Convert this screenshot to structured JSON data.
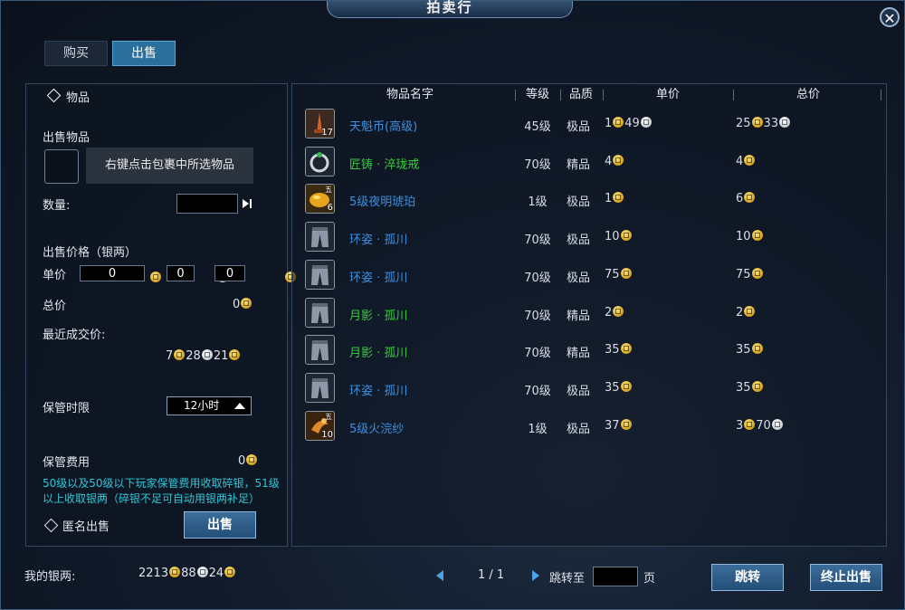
{
  "window": {
    "title": "拍卖行"
  },
  "tabs": {
    "buy": "购买",
    "sell": "出售"
  },
  "left": {
    "header": "物品",
    "sell_item_label": "出售物品",
    "hint": "右键点击包裹中所选物品",
    "quantity_label": "数量:",
    "quantity_value": "",
    "price_section_label": "出售价格（银两）",
    "unit_price_label": "单价",
    "unit_price": {
      "gold": "0",
      "silver": "0",
      "copper": "0"
    },
    "total_label": "总价",
    "total_value": "0",
    "recent_label": "最近成交价:",
    "recent": {
      "a": "7",
      "b": "28",
      "c": "21"
    },
    "storage_time_label": "保管时限",
    "storage_time_value": "12小时",
    "storage_fee_label": "保管费用",
    "storage_fee_value": "0",
    "note": "50级以及50级以下玩家保管费用收取碎银，51级以上收取银两（碎银不足可自动用银两补足）",
    "anonymous_label": "匿名出售",
    "sell_button": "出售"
  },
  "table": {
    "headers": {
      "name": "物品名字",
      "level": "等级",
      "quality": "品质",
      "unit": "单价",
      "total": "总价"
    },
    "rows": [
      {
        "name": "天魁币(高级)",
        "count": "17",
        "tag": "",
        "level": "45级",
        "quality": "极品",
        "unit_a": "1",
        "unit_b": "49",
        "total_a": "25",
        "total_b": "33",
        "name_color": "#3d8fe0",
        "icon": "tower-icon"
      },
      {
        "name": "匠铸 · 淬珑戒",
        "count": "",
        "tag": "",
        "level": "70级",
        "quality": "精品",
        "unit_a": "4",
        "unit_b": "",
        "total_a": "4",
        "total_b": "",
        "name_color": "#38c83e",
        "icon": "ring-icon"
      },
      {
        "name": "5级夜明琥珀",
        "count": "6",
        "tag": "五",
        "level": "1级",
        "quality": "极品",
        "unit_a": "1",
        "unit_b": "",
        "total_a": "6",
        "total_b": "",
        "name_color": "#3d8fe0",
        "icon": "amber-gem-icon"
      },
      {
        "name": "环姿 · 孤川",
        "count": "",
        "tag": "",
        "level": "70级",
        "quality": "极品",
        "unit_a": "10",
        "unit_b": "",
        "total_a": "10",
        "total_b": "",
        "name_color": "#3d8fe0",
        "icon": "pants-icon"
      },
      {
        "name": "环姿 · 孤川",
        "count": "",
        "tag": "",
        "level": "70级",
        "quality": "极品",
        "unit_a": "75",
        "unit_b": "",
        "total_a": "75",
        "total_b": "",
        "name_color": "#3d8fe0",
        "icon": "pants-icon"
      },
      {
        "name": "月影 · 孤川",
        "count": "",
        "tag": "",
        "level": "70级",
        "quality": "精品",
        "unit_a": "2",
        "unit_b": "",
        "total_a": "2",
        "total_b": "",
        "name_color": "#38c83e",
        "icon": "pants-icon"
      },
      {
        "name": "月影 · 孤川",
        "count": "",
        "tag": "",
        "level": "70级",
        "quality": "精品",
        "unit_a": "35",
        "unit_b": "",
        "total_a": "35",
        "total_b": "",
        "name_color": "#38c83e",
        "icon": "pants-icon"
      },
      {
        "name": "环姿 · 孤川",
        "count": "",
        "tag": "",
        "level": "70级",
        "quality": "极品",
        "unit_a": "35",
        "unit_b": "",
        "total_a": "35",
        "total_b": "",
        "name_color": "#3d8fe0",
        "icon": "pants-icon"
      },
      {
        "name": "5级火浣纱",
        "count": "10",
        "tag": "五",
        "level": "1级",
        "quality": "极品",
        "unit_a": "37",
        "unit_b": "",
        "total_a": "3",
        "total_b": "70",
        "name_color": "#3d8fe0",
        "icon": "fire-silk-icon"
      }
    ]
  },
  "bottom": {
    "my_silver_label": "我的银两:",
    "silver": {
      "a": "2213",
      "b": "88",
      "c": "24"
    },
    "page_indicator": "1 / 1",
    "jump_label": "跳转至",
    "page_input": "",
    "page_suffix": "页",
    "jump_button": "跳转",
    "stop_button": "终止出售"
  },
  "colors": {
    "accent": "#2b6f9c",
    "quality_blue": "#3d8fe0",
    "quality_green": "#38c83e",
    "note": "#2fc7d8",
    "gold": "#d4a21a"
  }
}
